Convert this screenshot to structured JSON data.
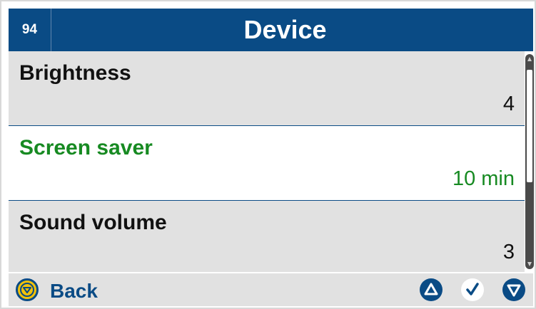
{
  "header": {
    "number": "94",
    "title": "Device"
  },
  "items": [
    {
      "label": "Brightness",
      "value": "4",
      "selected": false
    },
    {
      "label": "Screen saver",
      "value": "10 min",
      "selected": true
    },
    {
      "label": "Sound volume",
      "value": "3",
      "selected": false
    }
  ],
  "footer": {
    "back_label": "Back"
  },
  "colors": {
    "header_bg": "#0a4b85",
    "selected_text": "#178a22",
    "row_bg": "#e1e1e1",
    "back_icon": "#f2c20a"
  }
}
